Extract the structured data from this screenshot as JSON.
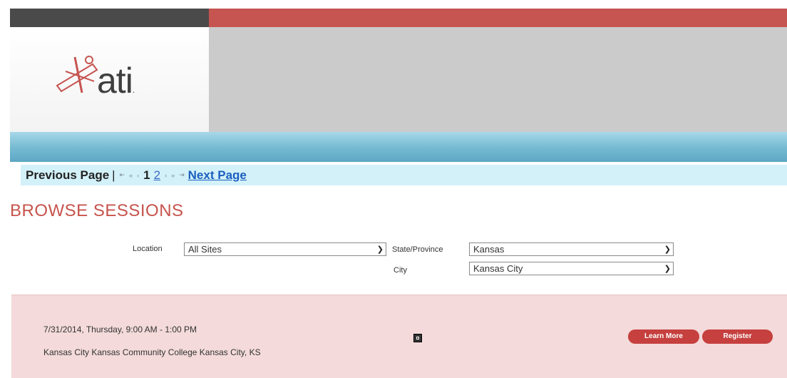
{
  "brand": {
    "logo_text": "ati",
    "logo_mark": "ati-figure-logo"
  },
  "colors": {
    "accent_red": "#c65450",
    "title_red": "#c7534d",
    "button_red": "#c5403e",
    "panel_pink": "#f4dada",
    "pager_bg": "#d3f1f9",
    "link_blue": "#1b5fbf"
  },
  "pager": {
    "previous_label": "Previous Page",
    "separator": "|",
    "first_icon": "⇤",
    "prev_fast_icon": "«",
    "prev_icon": "‹",
    "current_page": "1",
    "page_2": "2",
    "next_icon": "›",
    "next_fast_icon": "»",
    "last_icon": "⇥",
    "next_label": "Next Page"
  },
  "title": "BROWSE SESSIONS",
  "filters": {
    "location_label": "Location",
    "location_value": "All Sites",
    "state_label": "State/Province",
    "state_value": "Kansas",
    "city_label": "City",
    "city_value": "Kansas City"
  },
  "session": {
    "datetime": "7/31/2014, Thursday, 9:00 AM - 1:00 PM",
    "venue": "Kansas City Kansas Community College Kansas City, KS",
    "map_icon": "map-icon",
    "learn_more": "Learn More",
    "register": "Register"
  }
}
